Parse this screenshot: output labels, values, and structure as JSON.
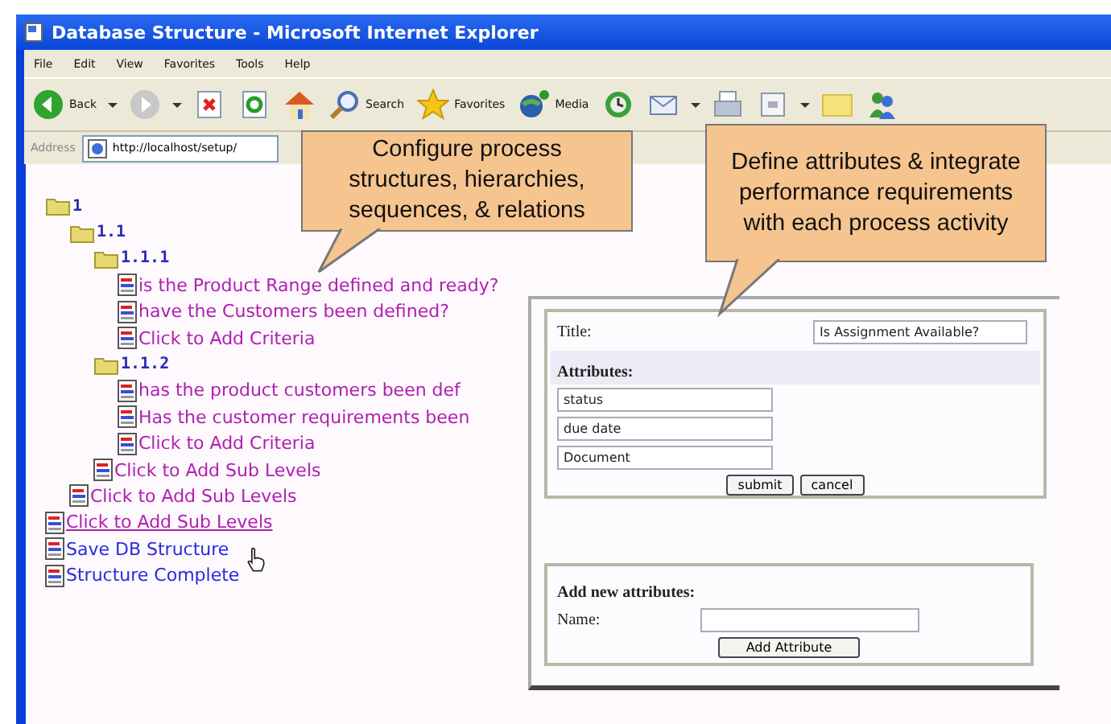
{
  "window": {
    "title": "Database Structure - Microsoft Internet Explorer"
  },
  "menu": [
    "File",
    "Edit",
    "View",
    "Favorites",
    "Tools",
    "Help"
  ],
  "toolbar": [
    {
      "kind": "back",
      "label": "Back"
    },
    {
      "kind": "forward"
    },
    {
      "kind": "stop"
    },
    {
      "kind": "refresh"
    },
    {
      "kind": "home"
    },
    {
      "kind": "search",
      "label": "Search"
    },
    {
      "kind": "favorites",
      "label": "Favorites"
    },
    {
      "kind": "media",
      "label": "Media"
    },
    {
      "kind": "history"
    },
    {
      "kind": "mail"
    },
    {
      "kind": "print"
    },
    {
      "kind": "edit"
    },
    {
      "kind": "folder"
    },
    {
      "kind": "messenger"
    }
  ],
  "address": {
    "label": "Address",
    "value": "http://localhost/setup/"
  },
  "tree": [
    {
      "kind": "folder",
      "label": "1",
      "visited": false,
      "hovered": false,
      "children": [
        {
          "kind": "folder",
          "label": "1.1",
          "visited": false,
          "hovered": false,
          "children": [
            {
              "kind": "folder",
              "label": "1.1.1",
              "visited": false,
              "hovered": false,
              "children": [
                {
                  "kind": "page",
                  "label": "is the Product Range defined and ready?",
                  "visited": true,
                  "hovered": false
                },
                {
                  "kind": "page",
                  "label": "have the Customers been defined?",
                  "visited": true,
                  "hovered": false
                },
                {
                  "kind": "page",
                  "label": "Click to Add Criteria",
                  "visited": true,
                  "hovered": false
                }
              ]
            },
            {
              "kind": "folder",
              "label": "1.1.2",
              "visited": false,
              "hovered": false,
              "children": [
                {
                  "kind": "page",
                  "label": "has the product customers been def",
                  "visited": true,
                  "hovered": false
                },
                {
                  "kind": "page",
                  "label": "Has the customer requirements been",
                  "visited": true,
                  "hovered": false
                },
                {
                  "kind": "page",
                  "label": "Click to Add Criteria",
                  "visited": true,
                  "hovered": false
                }
              ]
            },
            {
              "kind": "page",
              "label": "Click to Add Sub Levels",
              "visited": true,
              "hovered": false
            }
          ]
        },
        {
          "kind": "page",
          "label": "Click to Add Sub Levels",
          "visited": true,
          "hovered": false
        }
      ]
    },
    {
      "kind": "page",
      "label": "Click to Add Sub Levels",
      "visited": true,
      "hovered": true
    },
    {
      "kind": "page",
      "label": "Save DB Structure",
      "visited": false,
      "hovered": false
    },
    {
      "kind": "page",
      "label": "Structure Complete",
      "visited": false,
      "hovered": false
    }
  ],
  "form": {
    "title_label": "Title:",
    "title_value": "Is Assignment Available?",
    "attributes_heading": "Attributes:",
    "attributes": [
      "status",
      "due date",
      "Document"
    ],
    "buttons": [
      "submit",
      "cancel"
    ],
    "add_heading": "Add new attributes:",
    "name_label": "Name:",
    "add_button": "Add Attribute"
  },
  "callouts": [
    "Configure process structures, hierarchies, sequences, & relations",
    "Define attributes & integrate performance requirements with each process activity"
  ]
}
